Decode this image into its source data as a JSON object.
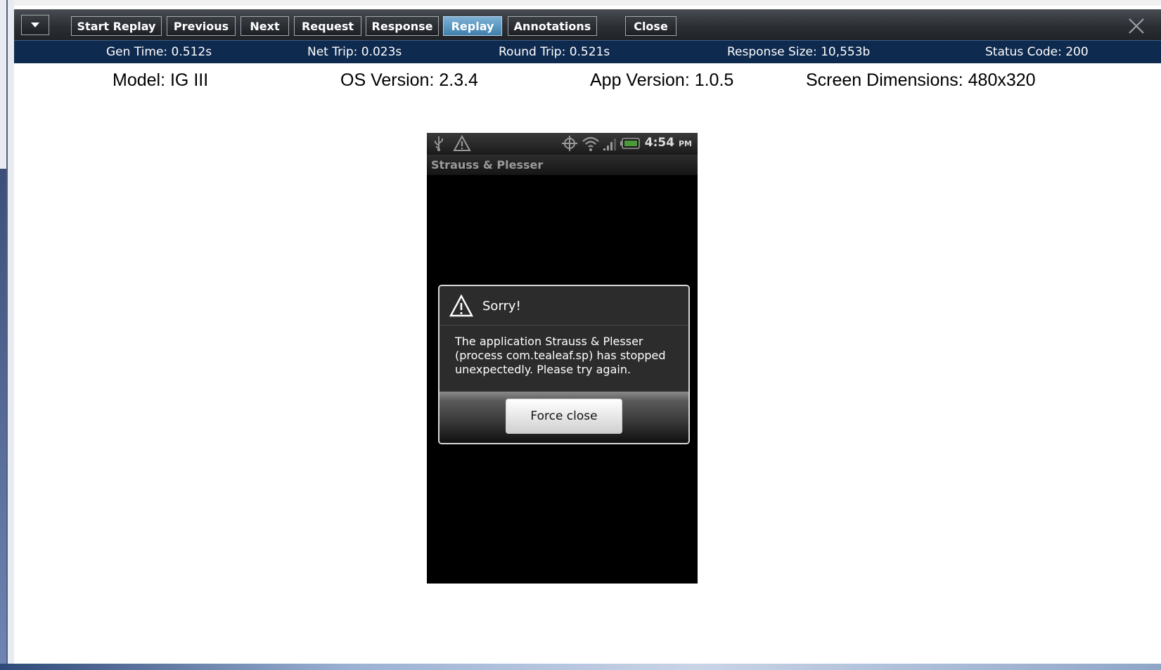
{
  "toolbar": {
    "menu_icon": "chevron-down-icon",
    "buttons": [
      {
        "label": "Start Replay",
        "active": false
      },
      {
        "label": "Previous",
        "active": false
      },
      {
        "label": "Next",
        "active": false
      },
      {
        "label": "Request",
        "active": false
      },
      {
        "label": "Response",
        "active": false
      },
      {
        "label": "Replay",
        "active": true
      },
      {
        "label": "Annotations",
        "active": false
      },
      {
        "label": "Close",
        "active": false
      }
    ],
    "close_icon": "close-icon"
  },
  "metrics": {
    "gen_time": "Gen Time: 0.512s",
    "net_trip": "Net Trip: 0.023s",
    "round_trip": "Round Trip: 0.521s",
    "response_size": "Response Size: 10,553b",
    "status_code": "Status Code: 200"
  },
  "device": {
    "model": "Model: IG III",
    "os_version": "OS Version: 2.3.4",
    "app_version": "App Version: 1.0.5",
    "screen_dimensions": "Screen Dimensions: 480x320"
  },
  "phone": {
    "status_bar": {
      "icons": [
        "usb-icon",
        "warning-icon",
        "gps-icon",
        "wifi-icon",
        "signal-icon",
        "battery-icon"
      ],
      "time": "4:54",
      "ampm": "PM"
    },
    "app_title": "Strauss & Plesser",
    "dialog": {
      "icon": "warning-icon",
      "title": "Sorry!",
      "message": "The application Strauss & Plesser (process com.tealeaf.sp) has stopped unexpectedly. Please try again.",
      "button": "Force close"
    }
  },
  "colors": {
    "toolbar_bg": "#2b2f34",
    "metrics_bg": "#0f2a4f",
    "active_button": "#5a9bc8"
  }
}
